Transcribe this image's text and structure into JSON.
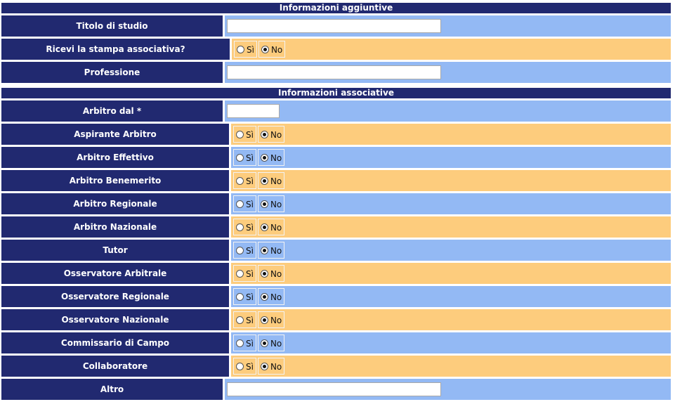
{
  "sections": [
    {
      "title": "Informazioni aggiuntive",
      "rows": [
        {
          "label": "Titolo di studio",
          "type": "text",
          "value": "",
          "bg": "blue"
        },
        {
          "label": "Ricevi la stampa associativa?",
          "type": "radio",
          "selected": "No",
          "bg": "orange"
        },
        {
          "label": "Professione",
          "type": "text",
          "value": "",
          "bg": "blue"
        }
      ]
    },
    {
      "title": "Informazioni associative",
      "rows": [
        {
          "label": "Arbitro dal *",
          "type": "text-short",
          "value": "",
          "bg": "blue"
        },
        {
          "label": "Aspirante Arbitro",
          "type": "radio",
          "selected": "No",
          "bg": "orange"
        },
        {
          "label": "Arbitro Effettivo",
          "type": "radio",
          "selected": "No",
          "bg": "blue"
        },
        {
          "label": "Arbitro Benemerito",
          "type": "radio",
          "selected": "No",
          "bg": "orange"
        },
        {
          "label": "Arbitro Regionale",
          "type": "radio",
          "selected": "No",
          "bg": "blue"
        },
        {
          "label": "Arbitro Nazionale",
          "type": "radio",
          "selected": "No",
          "bg": "orange"
        },
        {
          "label": "Tutor",
          "type": "radio",
          "selected": "No",
          "bg": "blue"
        },
        {
          "label": "Osservatore Arbitrale",
          "type": "radio",
          "selected": "No",
          "bg": "orange"
        },
        {
          "label": "Osservatore Regionale",
          "type": "radio",
          "selected": "No",
          "bg": "blue"
        },
        {
          "label": "Osservatore Nazionale",
          "type": "radio",
          "selected": "No",
          "bg": "orange"
        },
        {
          "label": "Commissario di Campo",
          "type": "radio",
          "selected": "No",
          "bg": "blue"
        },
        {
          "label": "Collaboratore",
          "type": "radio",
          "selected": "No",
          "bg": "orange"
        },
        {
          "label": "Altro",
          "type": "text",
          "value": "",
          "bg": "blue"
        }
      ]
    }
  ],
  "radio_options": [
    "Sì",
    "No"
  ],
  "colors": {
    "label_bg": "#212970",
    "blue_row": "#93b9f4",
    "orange_row": "#fdcc7d"
  }
}
